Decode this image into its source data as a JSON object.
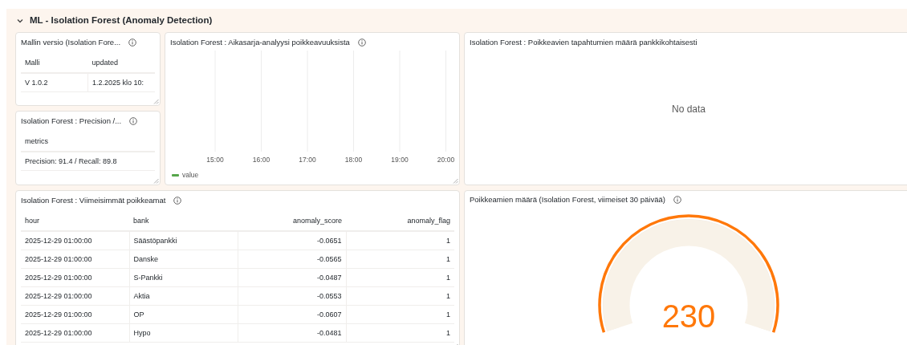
{
  "row_header": {
    "title": "ML - Isolation Forest (Anomaly Detection)",
    "expanded": true
  },
  "panels": [
    {
      "kind": "table",
      "title": "Mallin versio (Isolation Fore...",
      "info": true,
      "columns": [
        {
          "label": "Malli",
          "kind": "text"
        },
        {
          "label": "updated",
          "kind": "text"
        }
      ],
      "rows": [
        [
          "V 1.0.2",
          "1.2.2025 klo 10:"
        ]
      ]
    },
    {
      "kind": "table",
      "title": "Isolation Forest : Precision /...",
      "info": true,
      "columns": [
        {
          "label": "metrics",
          "kind": "text"
        }
      ],
      "rows": [
        [
          "Precision: 91.4 / Recall: 89.8"
        ]
      ]
    },
    {
      "kind": "timeseries",
      "title": "Isolation Forest : Aikasarja-analyysi poikkeavuuksista",
      "info": true,
      "x_tick_labels": [
        "15:00",
        "16:00",
        "17:00",
        "18:00",
        "19:00",
        "20:00"
      ],
      "legend": [
        {
          "name": "value",
          "color": "#56a64b"
        }
      ]
    },
    {
      "kind": "nodata",
      "title": "Isolation Forest : Poikkeavien tapahtumien määrä pankkikohtaisesti",
      "info": false,
      "message": "No data"
    },
    {
      "kind": "table",
      "title": "Isolation Forest : Viimeisimmät poikkeamat",
      "info": true,
      "columns": [
        {
          "label": "hour",
          "kind": "text"
        },
        {
          "label": "bank",
          "kind": "text"
        },
        {
          "label": "anomaly_score",
          "kind": "number"
        },
        {
          "label": "anomaly_flag",
          "kind": "number"
        }
      ],
      "rows": [
        [
          "2025-12-29 01:00:00",
          "Säästöpankki",
          "-0.0651",
          "1"
        ],
        [
          "2025-12-29 01:00:00",
          "Danske",
          "-0.0565",
          "1"
        ],
        [
          "2025-12-29 01:00:00",
          "S-Pankki",
          "-0.0487",
          "1"
        ],
        [
          "2025-12-29 01:00:00",
          "Aktia",
          "-0.0553",
          "1"
        ],
        [
          "2025-12-29 01:00:00",
          "OP",
          "-0.0607",
          "1"
        ],
        [
          "2025-12-29 01:00:00",
          "Hypo",
          "-0.0481",
          "1"
        ]
      ]
    },
    {
      "kind": "gauge",
      "title": "Poikkeamien määrä (Isolation Forest, viimeiset 30 päivää)",
      "info": true,
      "value": "230",
      "color": "#ff780a"
    }
  ]
}
